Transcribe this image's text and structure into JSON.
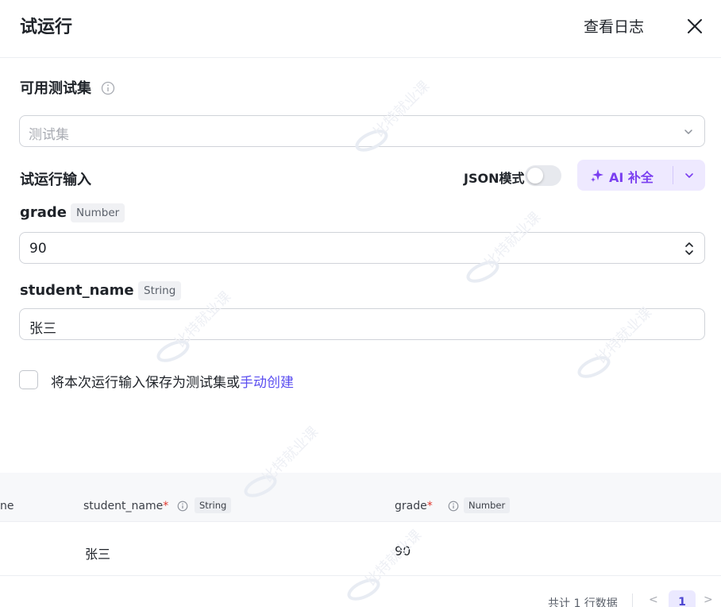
{
  "header": {
    "title": "试运行",
    "view_log": "查看日志"
  },
  "test_set": {
    "label": "可用测试集",
    "placeholder": "测试集"
  },
  "run_input": {
    "label": "试运行输入",
    "json_mode_label": "JSON模式",
    "json_mode_on": false,
    "ai_button_label": "AI 补全"
  },
  "fields": [
    {
      "name": "grade",
      "type": "Number",
      "value": "90"
    },
    {
      "name": "student_name",
      "type": "String",
      "value": "张三"
    }
  ],
  "save_option": {
    "text": "将本次运行输入保存为测试集或",
    "link": "手动创建",
    "checked": false
  },
  "table": {
    "partial_column": "ne",
    "columns": [
      {
        "name": "student_name",
        "type": "String"
      },
      {
        "name": "grade",
        "type": "Number"
      }
    ],
    "rows": [
      {
        "student_name": "张三",
        "grade": "90"
      }
    ],
    "summary": "共计 1 行数据",
    "page_prev": "<",
    "page_current": "1",
    "page_next": ">"
  },
  "watermark": {
    "text": "比特就业课"
  },
  "colors": {
    "accent": "#7a3ef0",
    "link": "#5a4df0",
    "required": "#e0382e",
    "ai_bg": "#eee9ff"
  }
}
